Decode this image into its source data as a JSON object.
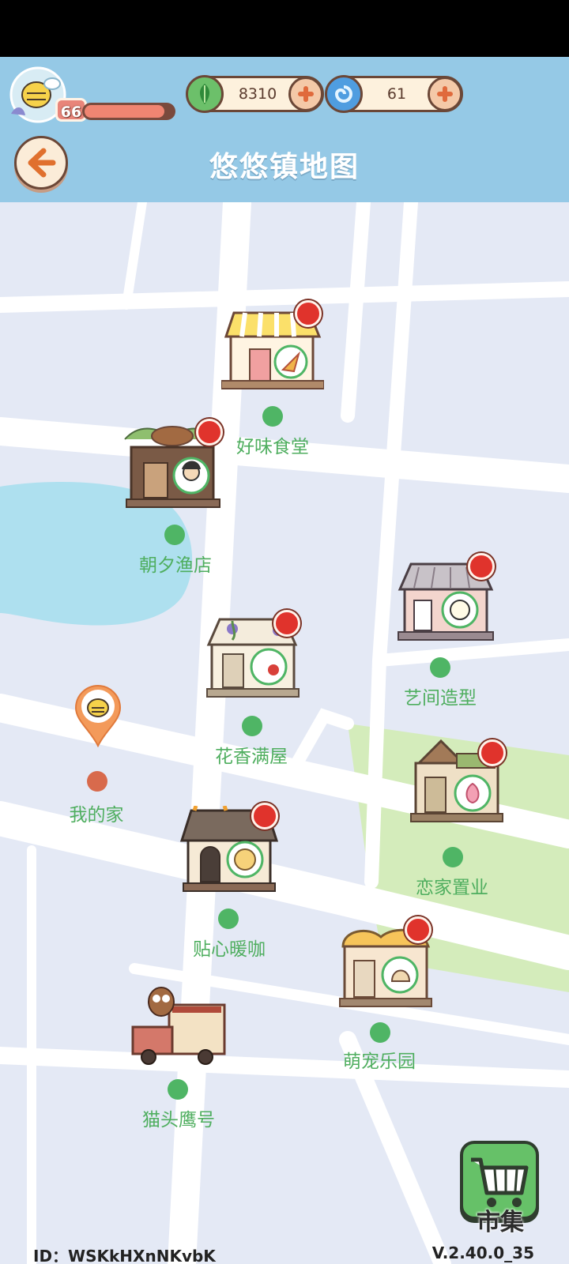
{
  "header": {
    "title": "悠悠镇地图",
    "level": "66",
    "xp_fraction": 0.9,
    "currency": [
      {
        "name": "leaf-coin",
        "value": "8310",
        "color": "#6cc06a"
      },
      {
        "name": "swirl-gem",
        "value": "61",
        "color": "#4f9de0"
      }
    ]
  },
  "map": {
    "locations": [
      {
        "name": "好味食堂",
        "alert": true
      },
      {
        "name": "朝夕渔店",
        "alert": true
      },
      {
        "name": "艺间造型",
        "alert": true
      },
      {
        "name": "花香满屋",
        "alert": true
      },
      {
        "name": "我的家",
        "alert": false
      },
      {
        "name": "恋家置业",
        "alert": true
      },
      {
        "name": "贴心暖咖",
        "alert": true
      },
      {
        "name": "萌宠乐园",
        "alert": true
      },
      {
        "name": "猫头鹰号",
        "alert": false
      }
    ]
  },
  "market": {
    "label": "市集"
  },
  "footer": {
    "id": "ID：WSKkHXnNKvbK",
    "version": "V.2.40.0_35"
  },
  "colors": {
    "header_bg": "#95c9e6",
    "map_bg": "#e4e9f5",
    "road": "#ffffff",
    "water": "#aee0ef",
    "park": "#d4ecbb",
    "label_green": "#4fae5f",
    "alert_red": "#e0332c"
  }
}
